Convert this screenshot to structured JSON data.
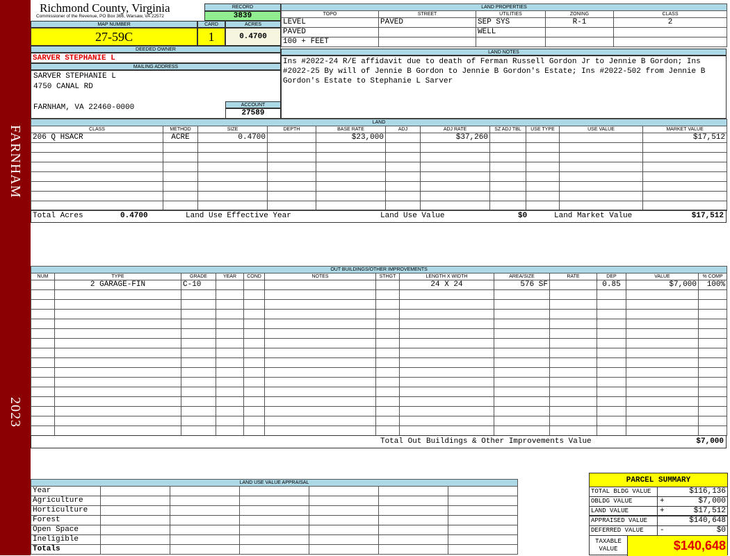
{
  "sidebar": {
    "district": "FARNHAM",
    "year": "2023"
  },
  "header": {
    "title": "Richmond County, Virginia",
    "subtitle": "Commissioner of the Revenue, PO Box 366, Warsaw, VA 22572"
  },
  "record": {
    "label": "RECORD",
    "value": "3839"
  },
  "map": {
    "label": "MAP NUMBER",
    "value": "27-59C"
  },
  "card": {
    "label": "CARD",
    "value": "1"
  },
  "acres": {
    "label": "ACRES",
    "value": "0.4700"
  },
  "owner": {
    "label": "DEEDED OWNER",
    "value": "SARVER STEPHANIE L"
  },
  "mailing": {
    "label": "MAILING ADDRESS",
    "line1": "SARVER STEPHANIE L",
    "line2": "4750 CANAL RD",
    "line3": "FARNHAM, VA 22460-0000"
  },
  "account": {
    "label": "ACCOUNT",
    "value": "27589"
  },
  "land_properties": {
    "label": "LAND PROPERTIES",
    "headers": [
      "TOPO",
      "STREET",
      "UTILITIES",
      "ZONING",
      "CLASS"
    ],
    "rows": [
      [
        "LEVEL",
        "PAVED",
        "SEP SYS",
        "R-1",
        "2"
      ],
      [
        "PAVED",
        "",
        "WELL",
        "",
        ""
      ],
      [
        "100 + FEET",
        "",
        "",
        "",
        ""
      ]
    ]
  },
  "land_notes": {
    "label": "LAND NOTES",
    "text": "Ins #2022-24 R/E affidavit due to death of Ferman Russell Gordon Jr to Jennie B Gordon; Ins #2022-25 By will of Jennie B Gordon to Jennie B Gordon's Estate; Ins #2022-502 from Jennie B Gordon's Estate to Stephanie L Sarver"
  },
  "land": {
    "label": "LAND",
    "headers": [
      "CLASS",
      "METHOD",
      "SIZE",
      "DEPTH",
      "BASE RATE",
      "ADJ",
      "ADJ RATE",
      "SZ ADJ TBL",
      "USE TYPE",
      "USE VALUE",
      "MARKET VALUE"
    ],
    "rows": [
      [
        "206 Q HSACR",
        "ACRE",
        "0.4700",
        "",
        "$23,000",
        "",
        "$37,260",
        "",
        "",
        "",
        "$17,512"
      ]
    ],
    "totals": {
      "acres_label": "Total Acres",
      "acres": "0.4700",
      "use_year_label": "Land Use Effective Year",
      "use_year": "",
      "use_value_label": "Land Use Value",
      "use_value": "$0",
      "market_label": "Land Market Value",
      "market": "$17,512"
    }
  },
  "outbuildings": {
    "label": "OUT BUILDINGS/OTHER IMPROVEMENTS",
    "headers": [
      "NUM",
      "TYPE",
      "GRADE",
      "YEAR",
      "COND",
      "NOTES",
      "STHGT",
      "LENGTH X WIDTH",
      "AREA/SIZE",
      "RATE",
      "DEP",
      "VALUE",
      "% COMP"
    ],
    "rows": [
      [
        "",
        "2 GARAGE-FIN",
        "C-10",
        "",
        "",
        "",
        "",
        "24 X 24",
        "576 SF",
        "",
        "0.85",
        "$7,000",
        "100%"
      ]
    ],
    "total_label": "Total Out Buildings & Other Improvements Value",
    "total": "$7,000"
  },
  "land_use": {
    "label": "LAND USE VALUE APPRAISAL",
    "rows": [
      "Year",
      "Agriculture",
      "Horticulture",
      "Forest",
      "Open Space",
      "Ineligible",
      "Totals"
    ]
  },
  "summary": {
    "title": "PARCEL SUMMARY",
    "rows": [
      {
        "label": "TOTAL BLDG VALUE",
        "op": "",
        "value": "$116,136"
      },
      {
        "label": "OBLDG VALUE",
        "op": "+",
        "value": "$7,000"
      },
      {
        "label": "LAND VALUE",
        "op": "+",
        "value": "$17,512"
      },
      {
        "label": "APPRAISED VALUE",
        "op": "",
        "value": "$140,648"
      },
      {
        "label": "DEFERRED VALUE",
        "op": "-",
        "value": "$0"
      }
    ],
    "taxable_label": "TAXABLE VALUE",
    "taxable": "$140,648"
  },
  "colors": {
    "sidebar": "#8b0000",
    "label_bg": "#add8e6",
    "record_bg": "#90ee90",
    "highlight": "#ffff00",
    "owner_text": "#e00000"
  }
}
